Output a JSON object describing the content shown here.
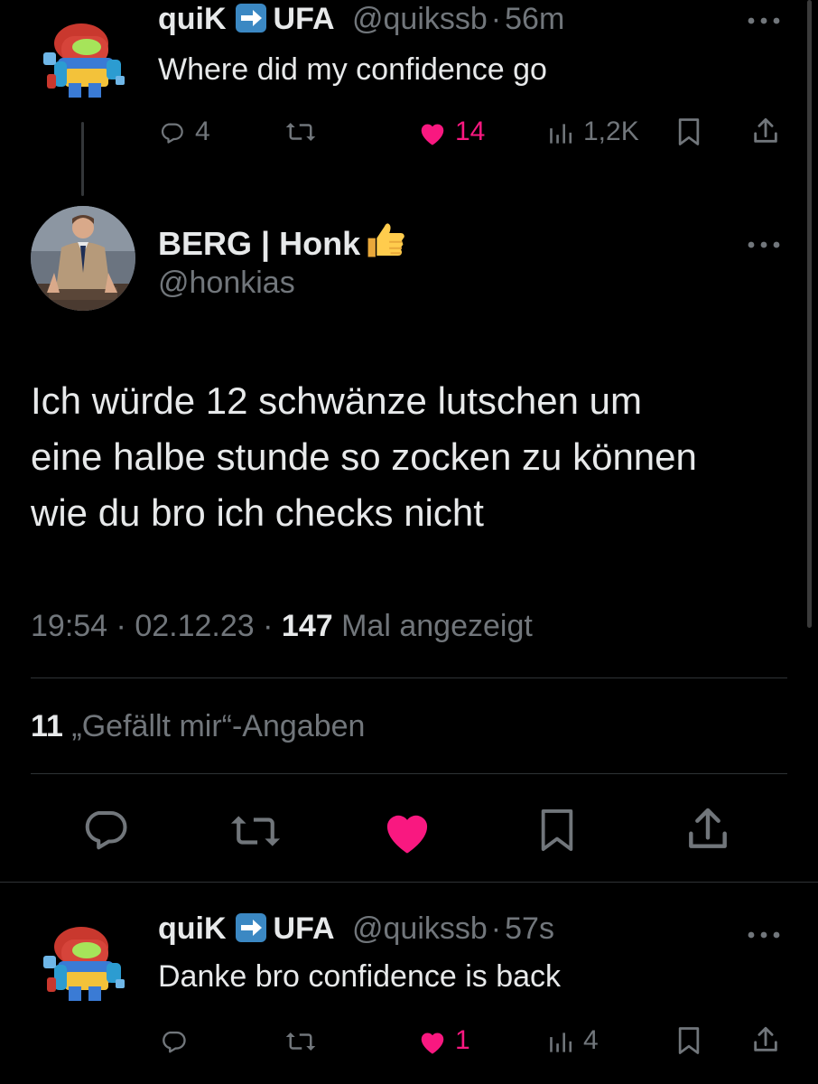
{
  "tweet1": {
    "display_name_left": "quiK",
    "display_name_right": "UFA",
    "handle": "@quikssb",
    "separator": "·",
    "time": "56m",
    "text": "Where did my confidence go",
    "replies": "4",
    "likes": "14",
    "views": "1,2K",
    "liked": true
  },
  "main_tweet": {
    "display_name": "BERG | Honk",
    "handle": "@honkias",
    "text_lines": [
      "Ich würde 12 schwänze lutschen um",
      "eine halbe stunde so zocken zu können",
      "wie du bro ich checks nicht"
    ],
    "time": "19:54",
    "date": "02.12.23",
    "sep": "·",
    "view_count": "147",
    "view_label": "Mal angezeigt",
    "likes_count": "11",
    "likes_label": "„Gefällt mir“-Angaben",
    "liked": true
  },
  "tweet2": {
    "display_name_left": "quiK",
    "display_name_right": "UFA",
    "handle": "@quikssb",
    "separator": "·",
    "time": "57s",
    "text": "Danke bro confidence is back",
    "likes": "1",
    "views": "4",
    "liked": true
  },
  "icons": {
    "reply": "reply-icon",
    "retweet": "retweet-icon",
    "like": "heart-icon",
    "views": "views-icon",
    "bookmark": "bookmark-icon",
    "share": "share-icon",
    "more": "more-icon",
    "arrow_emoji": "right-arrow-emoji",
    "thumbs_emoji": "thumbs-up-emoji"
  },
  "colors": {
    "background": "#000000",
    "text": "#e7e9ea",
    "secondary": "#71767b",
    "like": "#f91880",
    "divider": "#2f3336",
    "arrow_emoji": "#3b88c3"
  }
}
